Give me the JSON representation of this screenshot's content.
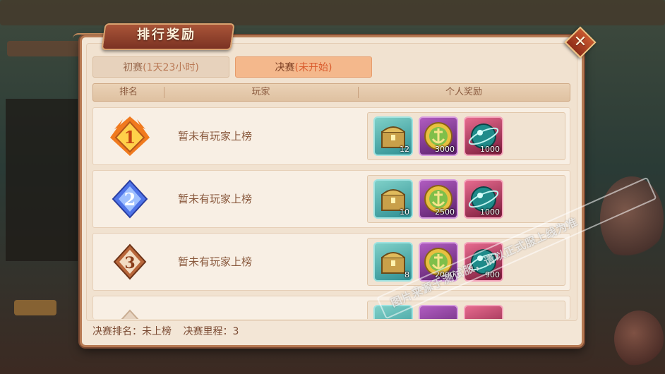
{
  "panel": {
    "title": "排行奖励",
    "close_icon": "close-x-icon"
  },
  "tabs": [
    {
      "label": "初赛",
      "status": "(1天23小时)",
      "active": false
    },
    {
      "label": "决赛",
      "status": "(未开始)",
      "active": true
    }
  ],
  "table": {
    "headers": [
      "排名",
      "玩家",
      "个人奖励"
    ],
    "rows": [
      {
        "rank": "1",
        "rank_icon": "rank-1-flame-badge-icon",
        "player": "暂未有玩家上榜",
        "rewards": [
          {
            "icon": "treasure-chest-icon",
            "count": "12"
          },
          {
            "icon": "gold-anchor-coin-icon",
            "count": "3000"
          },
          {
            "icon": "cyan-orb-icon",
            "count": "1000"
          }
        ]
      },
      {
        "rank": "2",
        "rank_icon": "rank-2-blue-badge-icon",
        "player": "暂未有玩家上榜",
        "rewards": [
          {
            "icon": "treasure-chest-icon",
            "count": "10"
          },
          {
            "icon": "gold-anchor-coin-icon",
            "count": "2500"
          },
          {
            "icon": "cyan-orb-icon",
            "count": "1000"
          }
        ]
      },
      {
        "rank": "3",
        "rank_icon": "rank-3-bronze-badge-icon",
        "player": "暂未有玩家上榜",
        "rewards": [
          {
            "icon": "treasure-chest-icon",
            "count": "8"
          },
          {
            "icon": "gold-anchor-coin-icon",
            "count": "2000"
          },
          {
            "icon": "cyan-orb-icon",
            "count": "900"
          }
        ]
      }
    ]
  },
  "footer": {
    "final_rank": "决赛排名：未上榜",
    "final_mileage": "决赛里程：3"
  },
  "watermark": "图片来源于测试服，请以正式服上线为准",
  "colors": {
    "panel_bg": "#f3e6d6",
    "panel_border": "#b77a53",
    "title_banner": "#8e3d28",
    "active_tab": "#f4b88c",
    "status_text": "#d95a2c",
    "text_brown": "#8a5a3e"
  }
}
